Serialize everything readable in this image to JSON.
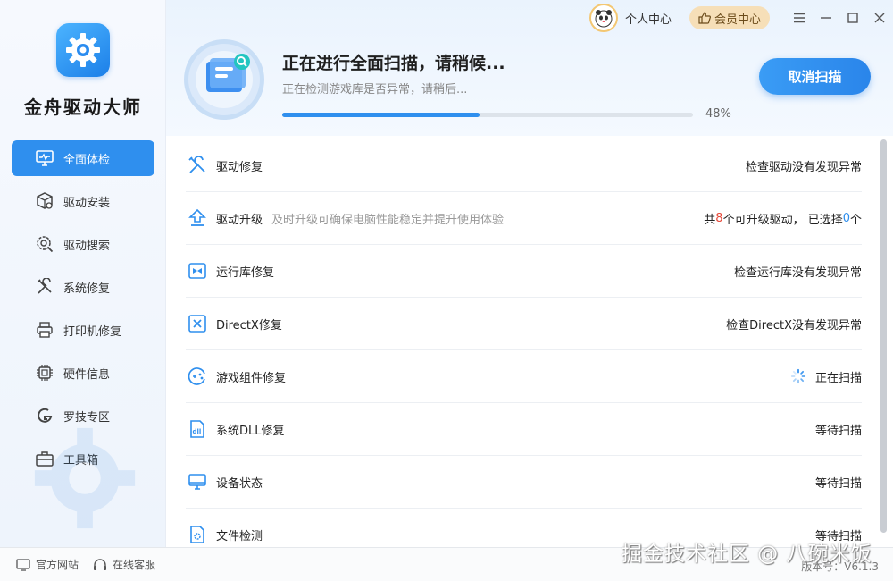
{
  "app": {
    "name": "金舟驱动大师"
  },
  "topbar": {
    "personal_center": "个人中心",
    "vip_center": "会员中心"
  },
  "sidebar": {
    "items": [
      {
        "label": "全面体检",
        "icon": "monitor-check-icon",
        "active": true
      },
      {
        "label": "驱动安装",
        "icon": "box-gear-icon"
      },
      {
        "label": "驱动搜索",
        "icon": "search-gear-icon"
      },
      {
        "label": "系统修复",
        "icon": "tools-icon"
      },
      {
        "label": "打印机修复",
        "icon": "printer-icon"
      },
      {
        "label": "硬件信息",
        "icon": "chip-icon"
      },
      {
        "label": "罗技专区",
        "icon": "logitech-icon"
      },
      {
        "label": "工具箱",
        "icon": "toolbox-icon"
      }
    ]
  },
  "scan": {
    "title": "正在进行全面扫描，请稍候...",
    "subtitle": "正在检测游戏库是否异常，请稍后...",
    "progress": 48,
    "progress_label": "48%",
    "cancel_label": "取消扫描"
  },
  "rows": [
    {
      "name": "驱动修复",
      "desc": "",
      "status": "检查驱动没有发现异常",
      "icon": "wrench-screwdriver-icon"
    },
    {
      "name": "驱动升级",
      "desc": "及时升级可确保电脑性能稳定并提升使用体验",
      "status_parts": {
        "prefix": "共",
        "count": "8",
        "mid": "个可升级驱动， 已选择",
        "selected": "0",
        "suffix": "个"
      },
      "icon": "upgrade-arrow-icon"
    },
    {
      "name": "运行库修复",
      "desc": "",
      "status": "检查运行库没有发现异常",
      "icon": "runtime-icon"
    },
    {
      "name": "DirectX修复",
      "desc": "",
      "status": "检查DirectX没有发现异常",
      "icon": "directx-icon"
    },
    {
      "name": "游戏组件修复",
      "desc": "",
      "status": "正在扫描",
      "icon": "gamepad-icon",
      "scanning": true
    },
    {
      "name": "系统DLL修复",
      "desc": "",
      "status": "等待扫描",
      "icon": "dll-file-icon"
    },
    {
      "name": "设备状态",
      "desc": "",
      "status": "等待扫描",
      "icon": "monitor-icon"
    },
    {
      "name": "文件检测",
      "desc": "",
      "status": "等待扫描",
      "icon": "file-gear-icon"
    }
  ],
  "footer": {
    "website": "官方网站",
    "support": "在线客服",
    "version": "版本号：V6.1.3"
  },
  "watermark": "掘金技术社区 @ 八碗米饭",
  "colors": {
    "accent": "#2f8fee",
    "highlight_red": "#e74a3b",
    "vip": "#f6dfb8"
  }
}
